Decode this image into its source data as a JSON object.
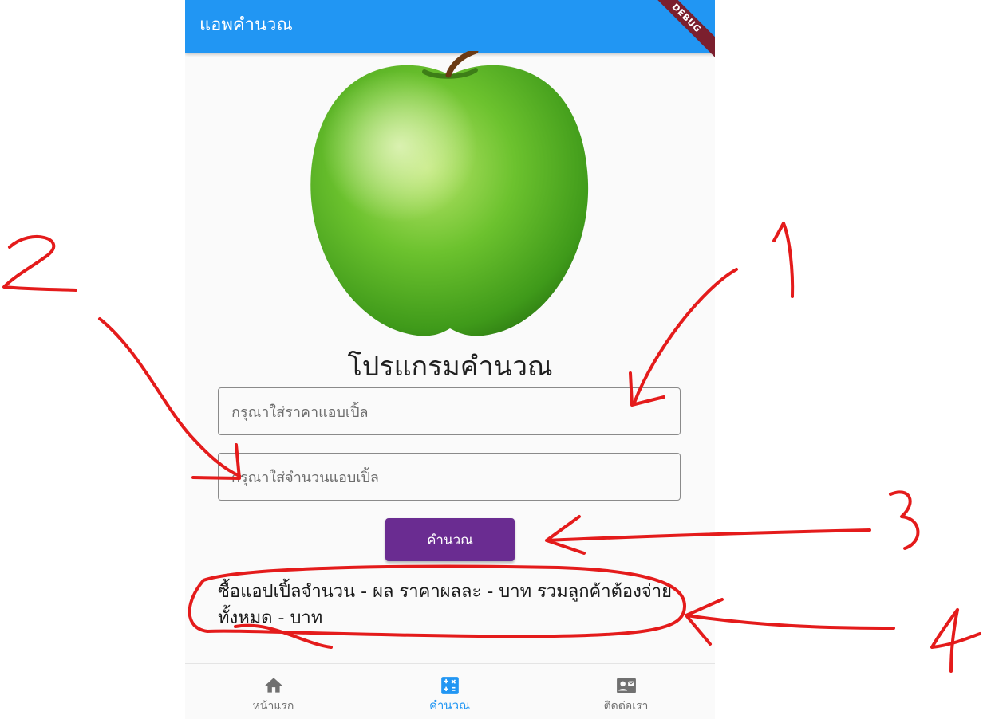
{
  "appbar": {
    "title": "แอพคำนวณ",
    "debug_label": "DEBUG",
    "color": "#2196f3"
  },
  "main": {
    "image": "green-apple",
    "heading": "โปรแกรมคำนวณ",
    "price_input": {
      "placeholder": "กรุณาใส่ราคาแอบเปิ้ล",
      "value": ""
    },
    "quantity_input": {
      "placeholder": "กรุณาใส่จำนวนแอบเปิ้ล",
      "value": ""
    },
    "calculate_button": {
      "label": "คำนวณ",
      "color": "#6a2c91"
    },
    "result_text": "ซื้อแอปเปิ้ลจำนวน - ผล ราคาผลละ - บาท รวมลูกค้าต้องจ่ายทั้งหมด - บาท"
  },
  "bottom_nav": {
    "items": [
      {
        "label": "หน้าแรก",
        "icon": "home-icon",
        "active": false
      },
      {
        "label": "คำนวณ",
        "icon": "calculator-icon",
        "active": true
      },
      {
        "label": "ติดต่อเรา",
        "icon": "contact-card-icon",
        "active": false
      }
    ]
  },
  "annotations": {
    "color": "#e41b1b",
    "numbers": [
      "1",
      "2",
      "3",
      "4"
    ]
  }
}
